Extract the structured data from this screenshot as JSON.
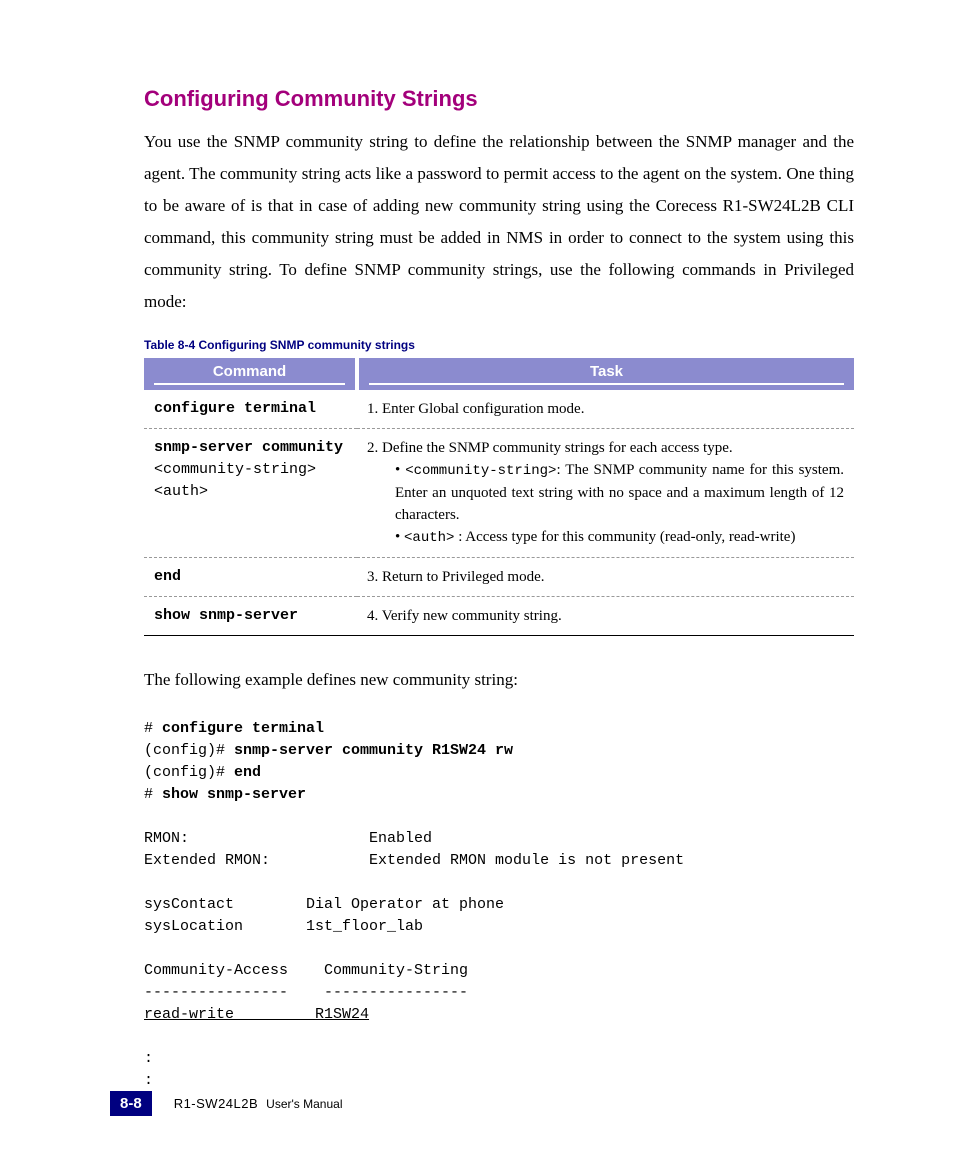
{
  "heading": "Configuring Community Strings",
  "intro": "You use the SNMP community string to define the relationship between the SNMP manager and the agent. The community string acts like a password to permit access to the agent on the system. One thing to be aware of is that in case of adding new community string using the Corecess R1-SW24L2B CLI command, this community string must be added in NMS in order to connect to the system using this community string. To define SNMP community strings, use the following commands in Privileged mode:",
  "table_caption": "Table 8-4   Configuring SNMP community strings",
  "table_headers": {
    "command": "Command",
    "task": "Task"
  },
  "rows": {
    "r1": {
      "cmd": "configure terminal",
      "task": "1.  Enter Global configuration mode."
    },
    "r2": {
      "cmd_line1": "snmp-server  community",
      "cmd_line2": "<community-string>",
      "cmd_line3": "<auth>",
      "task_line1": "2.  Define the SNMP community strings for each access type.",
      "bullet1_code": "<community-string>",
      "bullet1_text": ": The SNMP community name for this system. Enter an unquoted text string with no space and a maximum length of 12 characters.",
      "bullet2_code": "<auth>",
      "bullet2_text": " : Access type for this community (read-only, read-write)"
    },
    "r3": {
      "cmd": "end",
      "task": "3.  Return to Privileged mode."
    },
    "r4": {
      "cmd": "show snmp-server",
      "task": "4.  Verify new community string."
    }
  },
  "example_intro": "The following example defines new community string:",
  "code": {
    "l1_prompt": "# ",
    "l1_cmd": "configure terminal",
    "l2_prompt": "(config)# ",
    "l2_cmd": "snmp-server community R1SW24 rw",
    "l3_prompt": "(config)# ",
    "l3_cmd": "end",
    "l4_prompt": "# ",
    "l4_cmd": "show snmp-server",
    "blank": "",
    "o1": "RMON:                    Enabled",
    "o2": "Extended RMON:           Extended RMON module is not present",
    "o3": "sysContact        Dial Operator at phone",
    "o4": "sysLocation       1st_floor_lab",
    "o5": "Community-Access    Community-String",
    "o6": "----------------    ----------------",
    "o7a": "read-write         ",
    "o7b": "R1SW24",
    "o8": ":",
    "o9": ":"
  },
  "footer": {
    "page_number": "8-8",
    "model": "R1-SW24L2B",
    "manual": "User's Manual"
  }
}
